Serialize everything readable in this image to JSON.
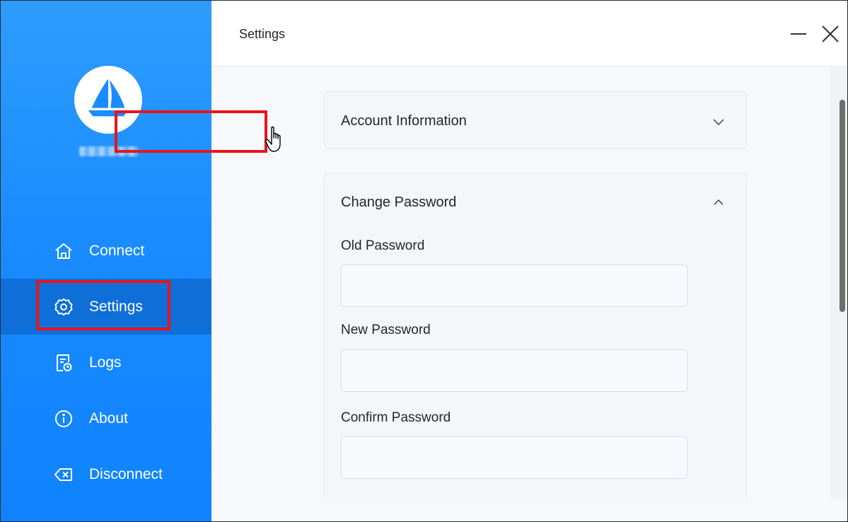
{
  "window": {
    "title": "Settings",
    "minimize_icon": "minimize-icon",
    "close_icon": "close-icon"
  },
  "sidebar": {
    "logo_icon": "sailboat-logo-icon",
    "items": [
      {
        "label": "Connect",
        "icon": "home-icon",
        "active": false
      },
      {
        "label": "Settings",
        "icon": "gear-icon",
        "active": true
      },
      {
        "label": "Logs",
        "icon": "log-icon",
        "active": false
      },
      {
        "label": "About",
        "icon": "info-icon",
        "active": false
      },
      {
        "label": "Disconnect",
        "icon": "disconnect-icon",
        "active": false
      }
    ]
  },
  "settings": {
    "account_panel": {
      "label": "Account Information",
      "expanded": false
    },
    "password_panel": {
      "label": "Change Password",
      "expanded": true,
      "fields": [
        {
          "label": "Old Password",
          "value": ""
        },
        {
          "label": "New Password",
          "value": ""
        },
        {
          "label": "Confirm Password",
          "value": ""
        }
      ]
    }
  },
  "colors": {
    "sidebar_accent": "#1a8cff",
    "sidebar_active": "#0e6fd8",
    "highlight": "#e8141c"
  }
}
